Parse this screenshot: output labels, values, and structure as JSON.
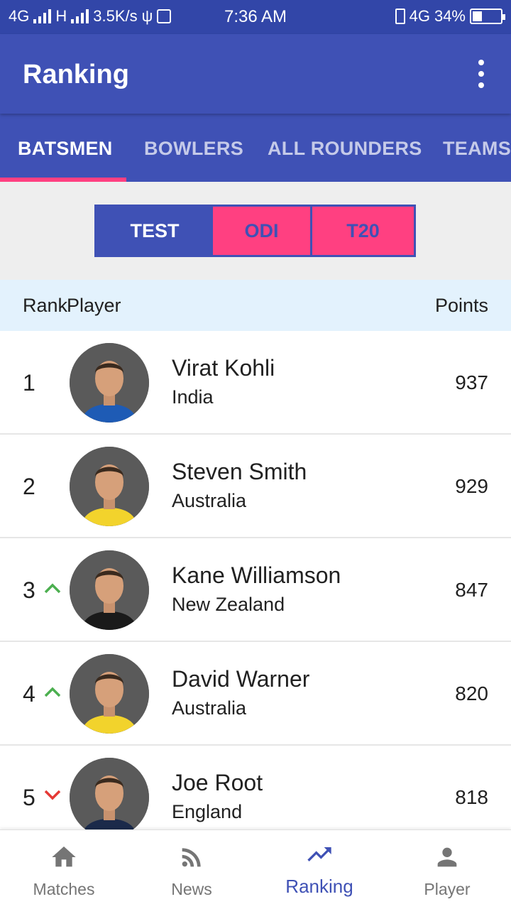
{
  "status_bar": {
    "network_left": "4G",
    "network_h": "H",
    "speed": "3.5K/s",
    "time": "7:36 AM",
    "network_right": "4G",
    "battery_text": "34%",
    "battery_level": 0.34
  },
  "app_bar": {
    "title": "Ranking",
    "overflow_icon": "more-vert-icon"
  },
  "tabs": [
    {
      "label": "BATSMEN",
      "active": true
    },
    {
      "label": "BOWLERS",
      "active": false
    },
    {
      "label": "ALL ROUNDERS",
      "active": false
    },
    {
      "label": "TEAMS",
      "active": false
    }
  ],
  "formats": [
    {
      "label": "TEST",
      "active": true
    },
    {
      "label": "ODI",
      "active": false
    },
    {
      "label": "T20",
      "active": false
    }
  ],
  "table_header": {
    "rank": "Rank",
    "player": "Player",
    "points": "Points"
  },
  "players": [
    {
      "rank": "1",
      "trend": "none",
      "name": "Virat Kohli",
      "country": "India",
      "points": "937",
      "jersey": "#1e5bb5"
    },
    {
      "rank": "2",
      "trend": "none",
      "name": "Steven Smith",
      "country": "Australia",
      "points": "929",
      "jersey": "#f2d32c"
    },
    {
      "rank": "3",
      "trend": "up",
      "name": "Kane Williamson",
      "country": "New Zealand",
      "points": "847",
      "jersey": "#1a1a1a"
    },
    {
      "rank": "4",
      "trend": "up",
      "name": "David Warner",
      "country": "Australia",
      "points": "820",
      "jersey": "#f2d32c"
    },
    {
      "rank": "5",
      "trend": "down",
      "name": "Joe Root",
      "country": "England",
      "points": "818",
      "jersey": "#1b2a4a"
    }
  ],
  "bottom_nav": [
    {
      "label": "Matches",
      "icon": "home-icon",
      "active": false
    },
    {
      "label": "News",
      "icon": "rss-feed-icon",
      "active": false
    },
    {
      "label": "Ranking",
      "icon": "trending-up-icon",
      "active": true
    },
    {
      "label": "Player",
      "icon": "person-icon",
      "active": false
    }
  ],
  "colors": {
    "primary": "#3f51b5",
    "primary_dark": "#3246a8",
    "accent": "#ff4081",
    "trend_up": "#4caf50",
    "trend_down": "#e53935",
    "header_bg": "#e3f2fd"
  }
}
